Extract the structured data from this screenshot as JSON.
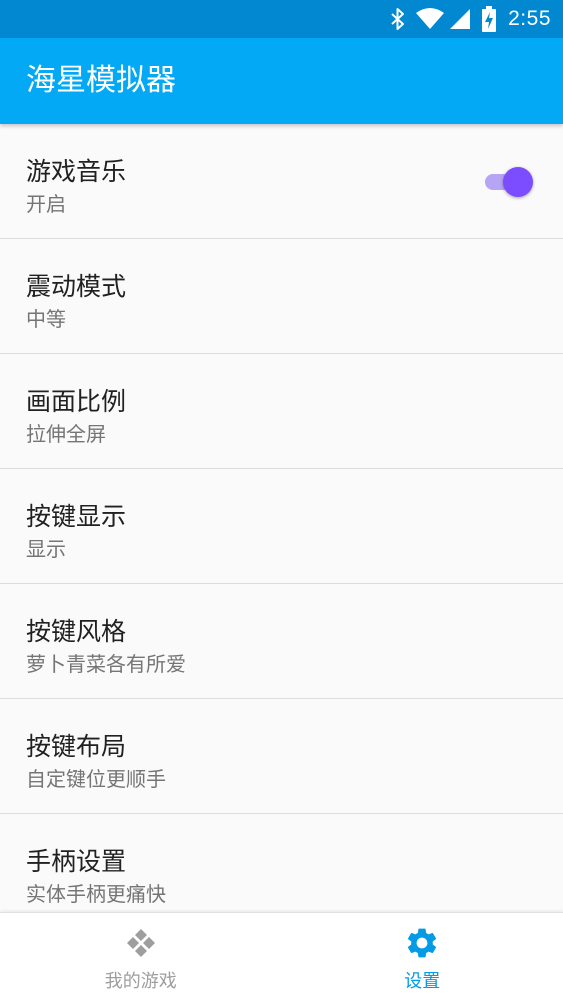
{
  "colors": {
    "status_bar": "#0288d1",
    "app_bar": "#03a9f4",
    "toggle_thumb": "#7c4dff",
    "toggle_track": "#b7a4f4",
    "nav_active": "#039be5",
    "nav_inactive": "#9e9e9e"
  },
  "status_bar": {
    "icons": [
      "bluetooth-icon",
      "wifi-icon",
      "cell-signal-icon",
      "battery-charging-icon"
    ],
    "time": "2:55"
  },
  "app_bar": {
    "title": "海星模拟器"
  },
  "settings": [
    {
      "title": "游戏音乐",
      "summary": "开启",
      "toggle": true,
      "toggle_on": true
    },
    {
      "title": "震动模式",
      "summary": "中等"
    },
    {
      "title": "画面比例",
      "summary": "拉伸全屏"
    },
    {
      "title": "按键显示",
      "summary": "显示"
    },
    {
      "title": "按键风格",
      "summary": "萝卜青菜各有所爱"
    },
    {
      "title": "按键布局",
      "summary": "自定键位更顺手"
    },
    {
      "title": "手柄设置",
      "summary": "实体手柄更痛快"
    }
  ],
  "bottom_nav": {
    "items": [
      {
        "label": "我的游戏",
        "icon": "gamepad-icon",
        "active": false
      },
      {
        "label": "设置",
        "icon": "gear-icon",
        "active": true
      }
    ]
  }
}
